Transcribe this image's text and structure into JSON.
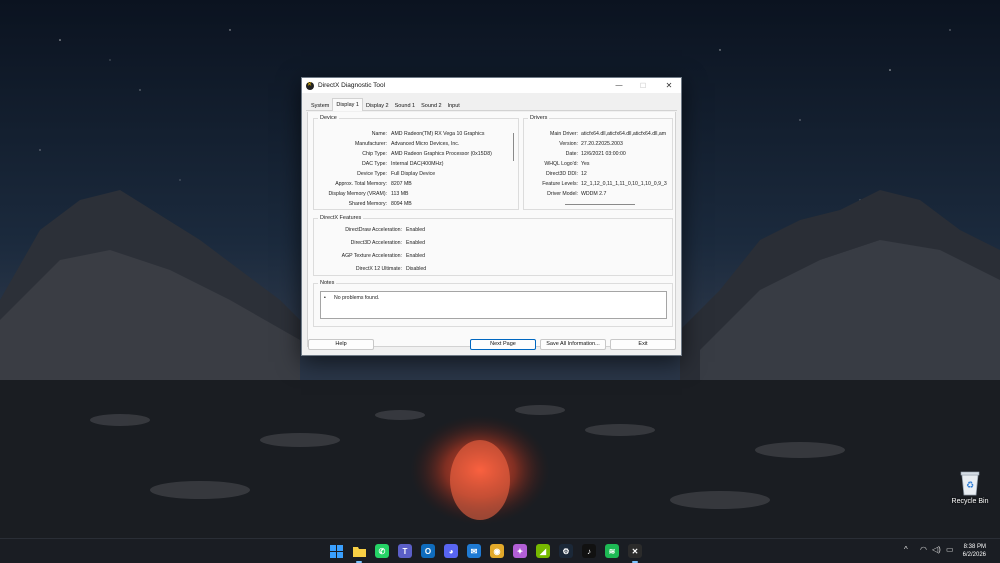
{
  "desktop": {
    "recycle_bin_label": "Recycle Bin"
  },
  "window": {
    "title": "DirectX Diagnostic Tool",
    "controls": {
      "minimize": "—",
      "maximize": "☐",
      "close": "✕"
    },
    "tabs": [
      {
        "label": "System"
      },
      {
        "label": "Display 1"
      },
      {
        "label": "Display 2"
      },
      {
        "label": "Sound 1"
      },
      {
        "label": "Sound 2"
      },
      {
        "label": "Input"
      }
    ],
    "active_tab": "Display 1",
    "device": {
      "title": "Device",
      "rows": [
        {
          "key": "Name:",
          "value": "AMD Radeon(TM) RX Vega 10 Graphics"
        },
        {
          "key": "Manufacturer:",
          "value": "Advanced Micro Devices, Inc."
        },
        {
          "key": "Chip Type:",
          "value": "AMD Radeon Graphics Processor (0x15D8)"
        },
        {
          "key": "DAC Type:",
          "value": "Internal DAC(400MHz)"
        },
        {
          "key": "Device Type:",
          "value": "Full Display Device"
        },
        {
          "key": "Approx. Total Memory:",
          "value": "8207 MB"
        },
        {
          "key": "Display Memory (VRAM):",
          "value": "113 MB"
        },
        {
          "key": "Shared Memory:",
          "value": "8094 MB"
        }
      ]
    },
    "drivers": {
      "title": "Drivers",
      "rows": [
        {
          "key": "Main Driver:",
          "value": "aticfx64.dll,aticfx64.dll,aticfx64.dll,am"
        },
        {
          "key": "Version:",
          "value": "27.20.22025.2003"
        },
        {
          "key": "Date:",
          "value": "12/6/2021 03:00:00"
        },
        {
          "key": "WHQL Logo'd:",
          "value": "Yes"
        },
        {
          "key": "Direct3D DDI:",
          "value": "12"
        },
        {
          "key": "Feature Levels:",
          "value": "12_1,12_0,11_1,11_0,10_1,10_0,9_3"
        },
        {
          "key": "Driver Model:",
          "value": "WDDM 2.7"
        }
      ]
    },
    "features": {
      "title": "DirectX Features",
      "rows": [
        {
          "key": "DirectDraw Acceleration:",
          "value": "Enabled"
        },
        {
          "key": "Direct3D Acceleration:",
          "value": "Enabled"
        },
        {
          "key": "AGP Texture Acceleration:",
          "value": "Enabled"
        },
        {
          "key": "DirectX 12 Ultimate:",
          "value": "Disabled"
        }
      ]
    },
    "notes": {
      "title": "Notes",
      "bullet": "•",
      "text": "No problems found."
    },
    "buttons": {
      "help": "Help",
      "next_page": "Next Page",
      "save_all": "Save All Information...",
      "exit": "Exit"
    }
  },
  "taskbar": {
    "apps": [
      {
        "name": "start-icon",
        "glyph": "",
        "color": "#2f8ff0"
      },
      {
        "name": "file-explorer-icon",
        "glyph": "",
        "color": "#f2c230"
      },
      {
        "name": "whatsapp-icon",
        "glyph": "✆",
        "color": "#25d366"
      },
      {
        "name": "teams-icon",
        "glyph": "T",
        "color": "#5b5fc7"
      },
      {
        "name": "outlook-icon",
        "glyph": "O",
        "color": "#0f6cbd"
      },
      {
        "name": "discord-icon",
        "glyph": "◕",
        "color": "#5865f2"
      },
      {
        "name": "mail-icon",
        "glyph": "✉",
        "color": "#1f7ad3"
      },
      {
        "name": "chrome-icon",
        "glyph": "◉",
        "color": "#e2a92a"
      },
      {
        "name": "copilot-icon",
        "glyph": "✦",
        "color": "#b25fd6"
      },
      {
        "name": "nvidia-icon",
        "glyph": "◢",
        "color": "#76b900"
      },
      {
        "name": "steam-icon",
        "glyph": "⚙",
        "color": "#1b2838"
      },
      {
        "name": "tiktok-icon",
        "glyph": "♪",
        "color": "#111111"
      },
      {
        "name": "spotify-icon",
        "glyph": "≋",
        "color": "#1db954"
      },
      {
        "name": "dxdiag-icon",
        "glyph": "✕",
        "color": "#2b2b2b"
      }
    ],
    "tray": {
      "chevron": "^",
      "wifi": "◠",
      "volume": "◁)",
      "battery": "▭"
    },
    "clock": {
      "time": "8:38 PM",
      "date": "6/2/2026"
    }
  }
}
